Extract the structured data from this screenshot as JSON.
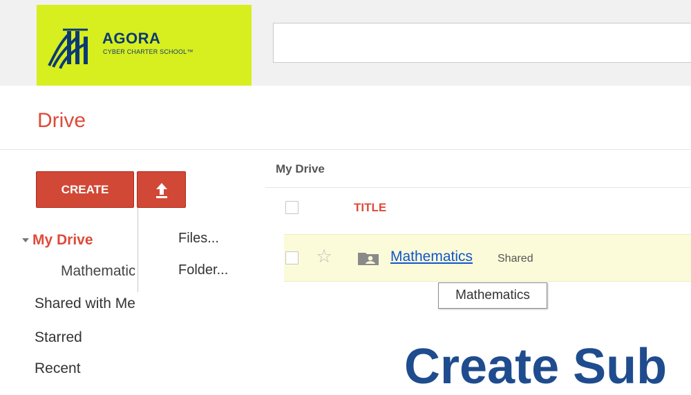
{
  "header": {
    "logo_main": "AGORA",
    "logo_sub": "CYBER CHARTER SCHOOL™",
    "search_value": ""
  },
  "drive": {
    "title": "Drive"
  },
  "actions": {
    "create_label": "CREATE",
    "upload_icon": "upload-arrow-icon",
    "menu_items": [
      "Files...",
      "Folder..."
    ]
  },
  "nav": {
    "my_drive": "My Drive",
    "child_item": "Mathematics",
    "shared_with_me": "Shared with Me",
    "starred": "Starred",
    "recent": "Recent"
  },
  "main": {
    "breadcrumb": "My Drive",
    "column_title": "TITLE",
    "rows": [
      {
        "name": "Mathematics",
        "shared_label": "Shared",
        "icon": "shared-folder-icon"
      }
    ],
    "tooltip": "Mathematics"
  },
  "overlay": {
    "heading_visible": "Create Sub"
  },
  "colors": {
    "accent_red": "#dd4b39",
    "button_red": "#d14836",
    "logo_bg": "#d7ee1f",
    "link_blue": "#1155cc",
    "row_highlight": "#fbfbd9",
    "overlay_blue": "#1f4c8e"
  }
}
